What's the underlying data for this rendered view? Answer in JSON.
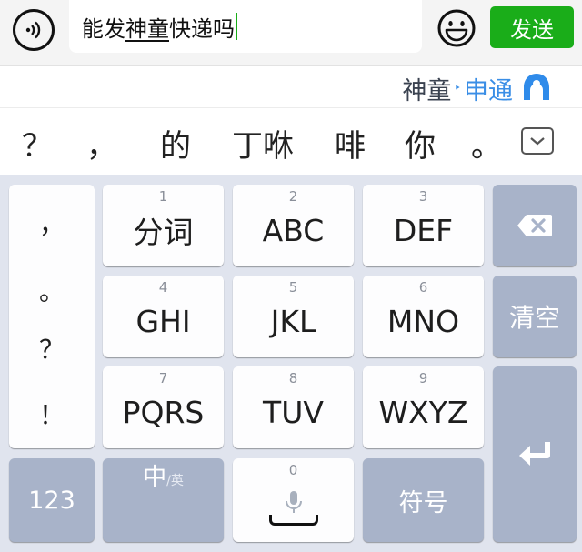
{
  "input": {
    "text_before": "能发",
    "text_underlined": "神童",
    "text_after": "快递吗",
    "send_label": "发送"
  },
  "suggestion": {
    "original": "神童",
    "arrow": "‣",
    "corrected": "申通"
  },
  "candidates": [
    "？",
    "，",
    "的",
    "丁咻",
    "啡",
    "你",
    "。"
  ],
  "keyboard": {
    "punctuation": [
      "，",
      "。",
      "？",
      "！"
    ],
    "keys": [
      {
        "num": "1",
        "label": "分词"
      },
      {
        "num": "2",
        "label": "ABC"
      },
      {
        "num": "3",
        "label": "DEF"
      },
      {
        "num": "4",
        "label": "GHI"
      },
      {
        "num": "5",
        "label": "JKL"
      },
      {
        "num": "6",
        "label": "MNO"
      },
      {
        "num": "7",
        "label": "PQRS"
      },
      {
        "num": "8",
        "label": "TUV"
      },
      {
        "num": "9",
        "label": "WXYZ"
      }
    ],
    "clear_label": "清空",
    "numbers_label": "123",
    "lang_zh": "中",
    "lang_en": "/英",
    "space_num": "0",
    "symbols_label": "符号"
  },
  "colors": {
    "send_green": "#1aad19",
    "suggest_blue": "#3a8ee6",
    "dark_key": "#a8b3c9",
    "keyboard_bg": "#e0e4ee"
  },
  "icons": [
    "voice-input-icon",
    "emoji-icon",
    "brand-logo-icon",
    "collapse-chevron-icon",
    "backspace-icon",
    "microphone-icon",
    "enter-icon"
  ]
}
